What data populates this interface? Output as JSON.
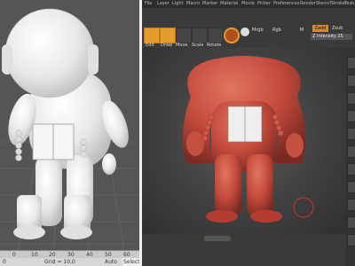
{
  "left_app": {
    "ruler_ticks": [
      "0",
      "10",
      "20",
      "30",
      "40",
      "50",
      "60"
    ],
    "status": {
      "coords": "0",
      "grid": "Grid = 10,0",
      "auto": "Auto",
      "select": "Selecte"
    }
  },
  "right_app": {
    "menu": [
      "File",
      "Layer",
      "Light",
      "Macro",
      "Marker",
      "Material",
      "Movie",
      "Picker",
      "Preferences",
      "Render",
      "Stencil",
      "Stroke",
      "Texture"
    ],
    "tools": [
      "Edit",
      "Draw",
      "Move",
      "Scale",
      "Rotate"
    ],
    "mrgb": "Mrgb",
    "rgb": "Rgb",
    "m_label": "M",
    "zadd": "Zadd",
    "zsub": "Zsub",
    "z_intensity": "Z Intensity 25"
  },
  "colors": {
    "clay": "#c44a3c",
    "accent": "#e59b2e",
    "white_model": "#f0f0f0"
  }
}
